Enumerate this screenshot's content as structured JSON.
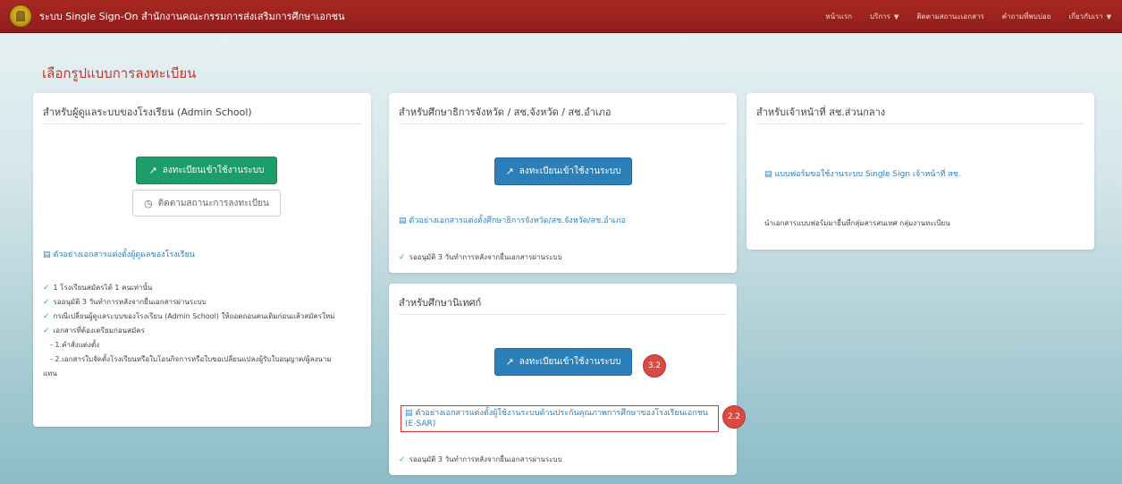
{
  "header": {
    "title": "ระบบ Single Sign-On สำนักงานคณะกรรมการส่งเสริมการศึกษาเอกชน",
    "menu": [
      {
        "label": "หน้าแรก"
      },
      {
        "label": "บริการ",
        "has_caret": true
      },
      {
        "label": "ติดตามสถานะเอกสาร"
      },
      {
        "label": "คำถามที่พบบ่อย"
      },
      {
        "label": "เกี่ยวกับเรา",
        "has_caret": true
      }
    ]
  },
  "page": {
    "title": "เลือกรูปแบบการลงทะเบียน"
  },
  "cards": {
    "admin_school": {
      "title": "สำหรับผู้ดูแลระบบของโรงเรียน (Admin School)",
      "register_button": "ลงทะเบียนเข้าใช้งานระบบ",
      "track_button": "ติดตามสถานะการลงทะเบียน",
      "doc_link": "ตัวอย่างเอกสารแต่งตั้งผู้ดูแลของโรงเรียน",
      "notes": [
        "1 โรงเรียนสมัครได้ 1 คนเท่านั้น",
        "รออนุมัติ 3 วันทำการหลังจากยื่นเอกสารผ่านระบบ",
        "กรณีเปลี่ยนผู้ดูแลระบบของโรงเรียน (Admin School) ให้ถอดถอนคนเดิมก่อนแล้วสมัครใหม่",
        "เอกสารที่ต้องเตรียมก่อนสมัคร"
      ],
      "sub_notes": [
        "- 1.คำสั่งแต่งตั้ง",
        "- 2.เอกสารใบจัดตั้งโรงเรียนหรือใบโอนกิจการหรือใบขอเปลี่ยนแปลงผู้รับใบอนุญาต/ผู้ลงนาม",
        "แทน"
      ]
    },
    "provincial": {
      "title": "สำหรับศึกษาธิการจังหวัด / สช.จังหวัด / สช.อำเภอ",
      "register_button": "ลงทะเบียนเข้าใช้งานระบบ",
      "doc_link": "ตัวอย่างเอกสารแต่งตั้งศึกษาธิการจังหวัด/สช.จังหวัด/สช.อำเภอ",
      "note": "รออนุมัติ 3 วันทำการหลังจากยื่นเอกสารผ่านระบบ"
    },
    "supervisor": {
      "title": "สำหรับศึกษานิเทศก์",
      "register_button": "ลงทะเบียนเข้าใช้งานระบบ",
      "doc_link_line1": "ตัวอย่างเอกสารแต่งตั้งผู้ใช้งานระบบด้านประกันคุณภาพการศึกษาของโรงเรียนเอกชน",
      "doc_link_line2": "(E-SAR)",
      "note": "รออนุมัติ 3 วันทำการหลังจากยื่นเอกสารผ่านระบบ",
      "badge_button": "3.2",
      "badge_link": "2.2"
    },
    "central": {
      "title": "สำหรับเจ้าหน้าที่ สช.ส่วนกลาง",
      "doc_link": "แบบฟอร์มขอใช้งานระบบ Single Sign เจ้าหน้าที่ สช.",
      "note": "นำเอกสารแบบฟอร์มมายื่นที่กลุ่มสารสนเทศ กลุ่มงานทะเบียน"
    }
  },
  "icons": {
    "register": "share-square-icon",
    "clock": "clock-icon",
    "document": "document-icon",
    "check": "check-icon"
  },
  "colors": {
    "navbar": "#a92723",
    "accent_title": "#c0392b",
    "green_button": "#1d9d6a",
    "blue_button": "#2c7fb8",
    "link": "#2d7fc1",
    "badge": "#d94a43"
  }
}
